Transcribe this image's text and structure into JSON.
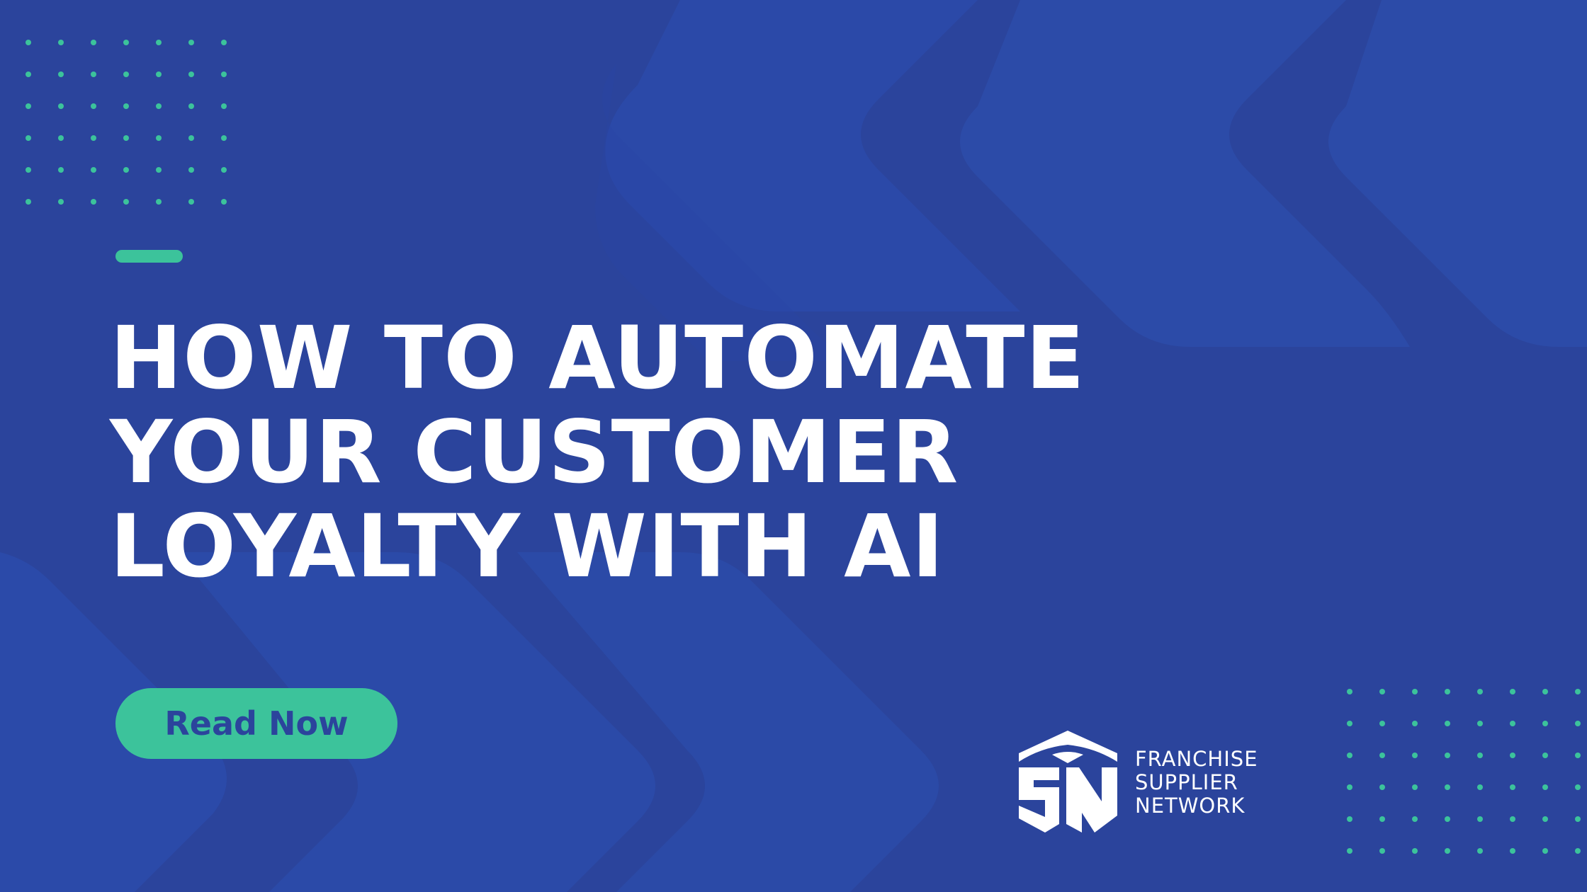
{
  "headline": {
    "line1": "HOW TO AUTOMATE",
    "line2": "YOUR CUSTOMER",
    "line3": "LOYALTY WITH AI"
  },
  "cta": {
    "label": "Read Now"
  },
  "brand": {
    "line1": "FRANCHISE",
    "line2": "SUPPLIER",
    "line3": "NETWORK",
    "logo_icon": "fsn-cube-logo"
  },
  "colors": {
    "background": "#2b449c",
    "accent": "#3cc39b",
    "text": "#ffffff"
  }
}
